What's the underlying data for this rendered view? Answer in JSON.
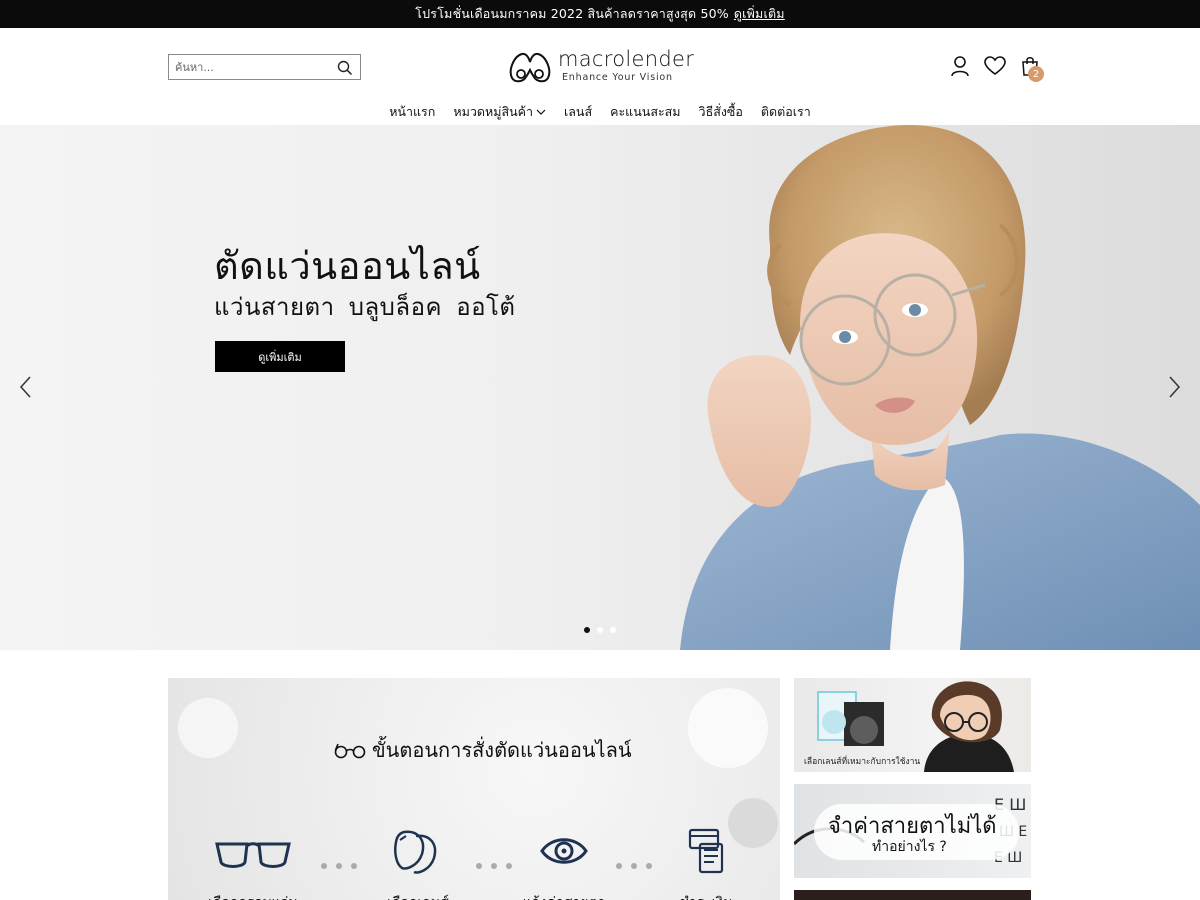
{
  "promo_bar": {
    "text": "โปรโมชั่นเดือนมกราคม 2022 สินค้าลดราคาสูงสุด 50%",
    "link": "ดูเพิ่มเติม"
  },
  "header": {
    "search_placeholder": "ค้นหา...",
    "logo_name": "macrolender",
    "logo_tagline": "Enhance Your Vision",
    "cart_count": "2"
  },
  "nav": {
    "items": [
      "หน้าแรก",
      "หมวดหมู่สินค้า",
      "เลนส์",
      "คะแนนสะสม",
      "วิธีสั่งซื้อ",
      "ติดต่อเรา"
    ]
  },
  "hero": {
    "title": "ตัดแว่นออนไลน์",
    "subtitle": "แว่นสายตา บลูบล็อค ออโต้",
    "button": "ดูเพิ่มเติม",
    "slides": 3,
    "active_slide": 1
  },
  "steps": {
    "title": "ขั้นตอนการสั่งตัดแว่นออนไลน์",
    "items": [
      "เลือกกรอบแว่น",
      "เลือกเลนส์",
      "แจ้งค่าสายตา",
      "ชำระเงิน"
    ]
  },
  "side_cards": {
    "card1_caption": "เลือกเลนส์ที่เหมาะกับการใช้งาน",
    "card2_line1": "จำค่าสายตาไม่ได้",
    "card2_line2": "ทำอย่างไร ?"
  },
  "colors": {
    "promo_bg": "#0b0b0b",
    "cart_badge": "#d79a6a",
    "cta_bg": "#000000"
  }
}
